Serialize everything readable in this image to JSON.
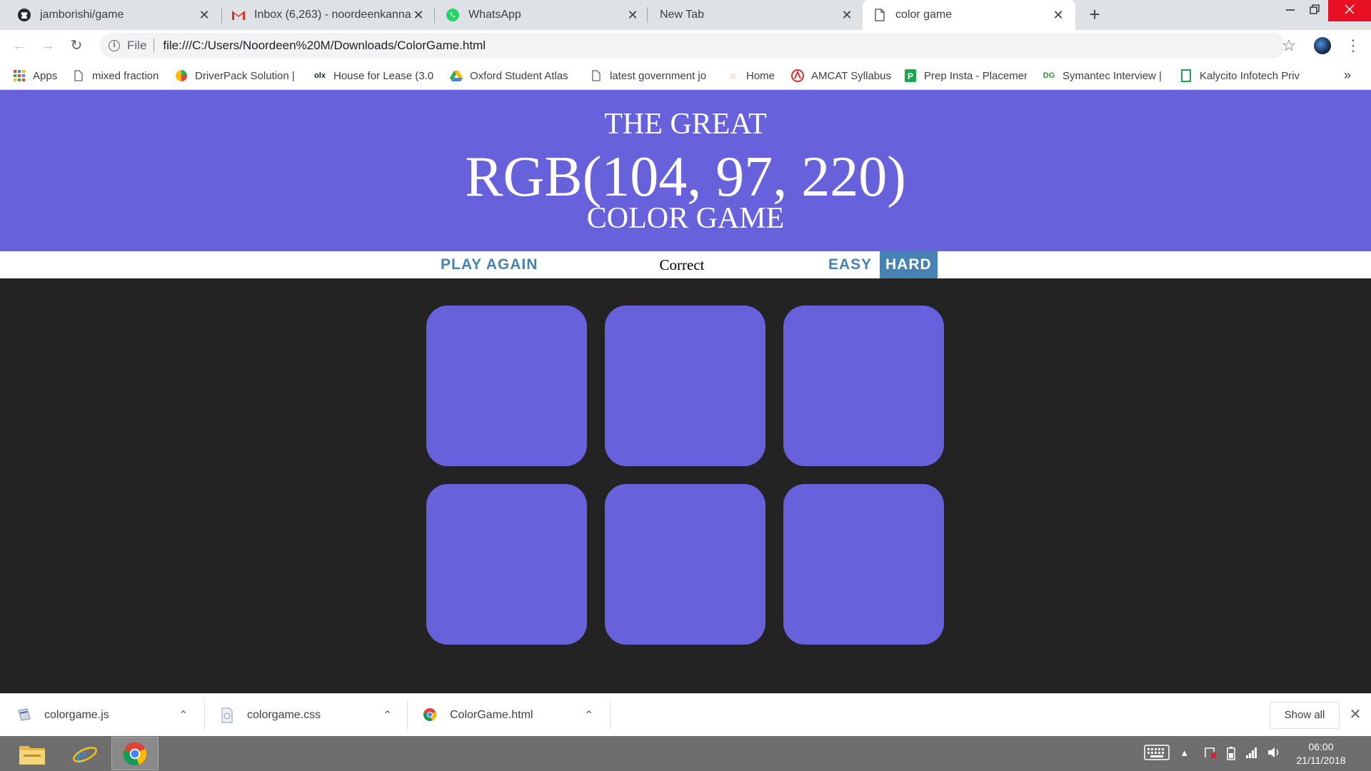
{
  "browser": {
    "tabs": [
      {
        "title": "jamborishi/game",
        "icon": "github-icon",
        "active": false
      },
      {
        "title": "Inbox (6,263) - noordeenkanna@",
        "icon": "gmail-icon",
        "active": false
      },
      {
        "title": "WhatsApp",
        "icon": "whatsapp-icon",
        "active": false
      },
      {
        "title": "New Tab",
        "icon": "none",
        "active": false
      },
      {
        "title": "color game",
        "icon": "page-icon",
        "active": true
      }
    ],
    "close_glyph": "✕",
    "new_tab_glyph": "+",
    "address": {
      "scheme": "File",
      "url": "file:///C:/Users/Noordeen%20M/Downloads/ColorGame.html"
    },
    "bookmarks": [
      {
        "label": "Apps",
        "icon": "apps-grid-icon"
      },
      {
        "label": "mixed fraction",
        "icon": "page-icon"
      },
      {
        "label": "DriverPack Solution |",
        "icon": "driverpack-icon"
      },
      {
        "label": "House for Lease (3.0",
        "icon": "olx-icon"
      },
      {
        "label": "Oxford Student Atlas",
        "icon": "google-drive-icon"
      },
      {
        "label": "latest government jo",
        "icon": "page-icon"
      },
      {
        "label": "Home",
        "icon": "home-icon"
      },
      {
        "label": "AMCAT Syllabus",
        "icon": "amcat-icon"
      },
      {
        "label": "Prep Insta - Placemer",
        "icon": "prepinsta-icon"
      },
      {
        "label": "Symantec Interview |",
        "icon": "symantec-icon"
      },
      {
        "label": "Kalycito Infotech Priv",
        "icon": "kalycito-icon"
      }
    ],
    "bookmarks_overflow": "»"
  },
  "game": {
    "title_top": "THE GREAT",
    "color_display": "RGB(104, 97, 220)",
    "title_bottom": "COLOR GAME",
    "reset_label": "PLAY AGAIN",
    "message": "Correct",
    "easy_label": "EASY",
    "hard_label": "HARD",
    "selected_mode": "hard",
    "header_color": "#6861dc",
    "squares": [
      "#6861dc",
      "#6861dc",
      "#6861dc",
      "#6861dc",
      "#6861dc",
      "#6861dc"
    ]
  },
  "downloads": {
    "items": [
      {
        "name": "colorgame.js",
        "icon": "js-file-icon"
      },
      {
        "name": "colorgame.css",
        "icon": "css-file-icon"
      },
      {
        "name": "ColorGame.html",
        "icon": "chrome-html-icon"
      }
    ],
    "show_all": "Show all"
  },
  "taskbar": {
    "apps": [
      "file-explorer-icon",
      "internet-explorer-icon",
      "chrome-icon"
    ],
    "time": "06:00",
    "date": "21/11/2018"
  }
}
